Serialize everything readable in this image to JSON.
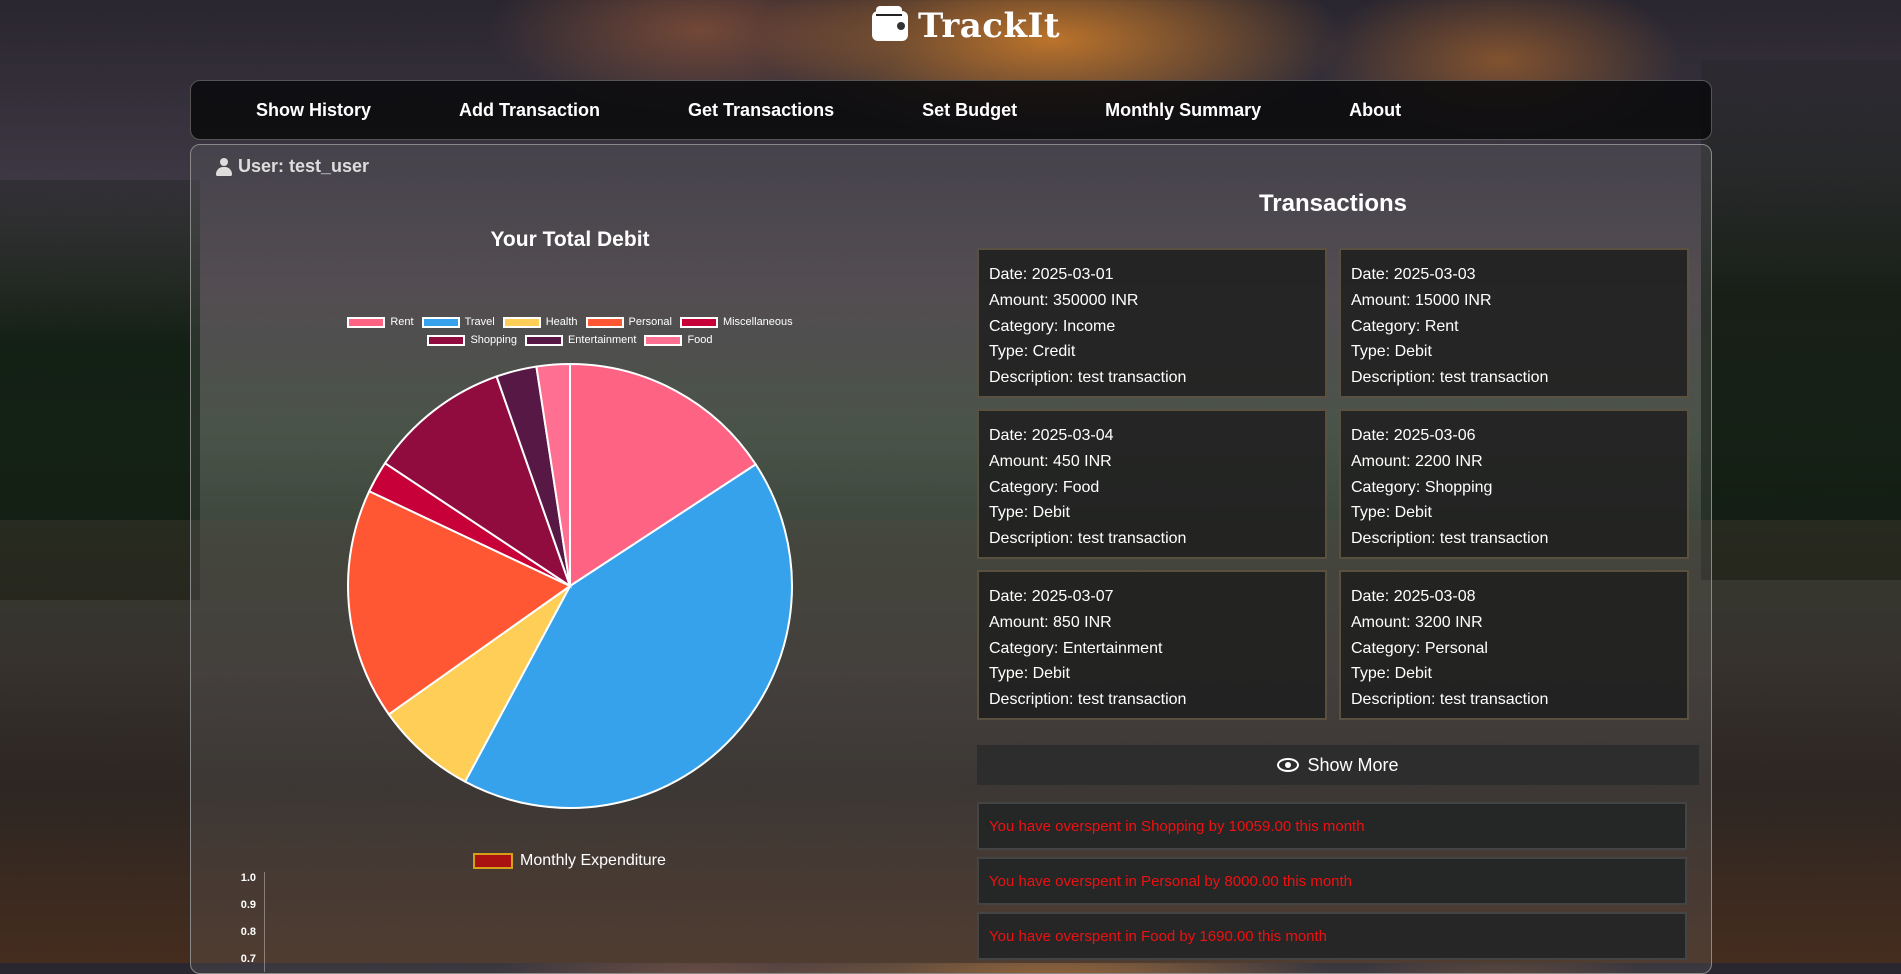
{
  "app": {
    "name": "TrackIt",
    "logo_icon": "wallet-icon"
  },
  "nav": {
    "items": [
      {
        "label": "Show History"
      },
      {
        "label": "Add Transaction"
      },
      {
        "label": "Get Transactions"
      },
      {
        "label": "Set Budget"
      },
      {
        "label": "Monthly Summary"
      },
      {
        "label": "About"
      }
    ]
  },
  "user": {
    "label": "User: test_user",
    "icon": "user-icon"
  },
  "chart_data": [
    {
      "type": "pie",
      "title": "Your Total Debit",
      "legend_position": "top",
      "categories": [
        "Rent",
        "Travel",
        "Health",
        "Personal",
        "Miscellaneous",
        "Shopping",
        "Entertainment",
        "Food"
      ],
      "values": [
        15000,
        40000,
        7000,
        16000,
        2200,
        9800,
        2800,
        2300
      ],
      "colors": [
        "#ff6384",
        "#36a2eb",
        "#ffce56",
        "#ff5733",
        "#c70039",
        "#900c3f",
        "#581845",
        "#ff6f91"
      ]
    },
    {
      "type": "bar",
      "series": [
        {
          "name": "Monthly Expenditure",
          "values": []
        }
      ],
      "yticks": [
        "1.0",
        "0.9",
        "0.8",
        "0.7"
      ],
      "colors": {
        "fill": "#aa1111",
        "border": "#d4a017"
      }
    }
  ],
  "transactions": {
    "heading": "Transactions",
    "items": [
      {
        "date": "Date: 2025-03-01",
        "amount": "Amount: 350000 INR",
        "category": "Category: Income",
        "type": "Type: Credit",
        "description": "Description: test transaction"
      },
      {
        "date": "Date: 2025-03-03",
        "amount": "Amount: 15000 INR",
        "category": "Category: Rent",
        "type": "Type: Debit",
        "description": "Description: test transaction"
      },
      {
        "date": "Date: 2025-03-04",
        "amount": "Amount: 450 INR",
        "category": "Category: Food",
        "type": "Type: Debit",
        "description": "Description: test transaction"
      },
      {
        "date": "Date: 2025-03-06",
        "amount": "Amount: 2200 INR",
        "category": "Category: Shopping",
        "type": "Type: Debit",
        "description": "Description: test transaction"
      },
      {
        "date": "Date: 2025-03-07",
        "amount": "Amount: 850 INR",
        "category": "Category: Entertainment",
        "type": "Type: Debit",
        "description": "Description: test transaction"
      },
      {
        "date": "Date: 2025-03-08",
        "amount": "Amount: 3200 INR",
        "category": "Category: Personal",
        "type": "Type: Debit",
        "description": "Description: test transaction"
      }
    ],
    "show_more_label": "Show More",
    "show_more_icon": "eye-icon"
  },
  "alerts": [
    "You have overspent in Shopping by 10059.00 this month",
    "You have overspent in Personal by 8000.00 this month",
    "You have overspent in Food by 1690.00 this month"
  ],
  "colors": {
    "alert_text": "#ee1111",
    "accent": "#36a2eb"
  }
}
